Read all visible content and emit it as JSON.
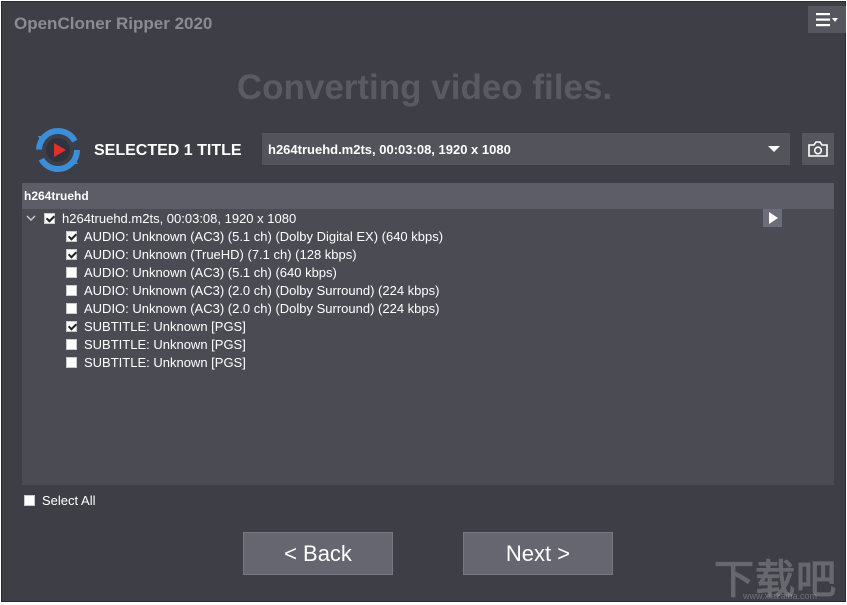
{
  "app": {
    "title": "OpenCloner Ripper 2020",
    "headline": "Converting video files.",
    "menu_icon": "hamburger-menu-icon"
  },
  "selection": {
    "label": "SELECTED 1 TITLE",
    "selected_title": "h264truehd.m2ts, 00:03:08, 1920 x 1080",
    "camera_icon": "camera-icon"
  },
  "panel": {
    "header": "h264truehd",
    "root": {
      "label": "h264truehd.m2ts, 00:03:08, 1920 x 1080",
      "checked": true
    },
    "tracks": [
      {
        "label": "AUDIO: Unknown (AC3) (5.1 ch) (Dolby Digital EX) (640 kbps)",
        "checked": true
      },
      {
        "label": "AUDIO: Unknown (TrueHD) (7.1 ch) (128 kbps)",
        "checked": true
      },
      {
        "label": "AUDIO: Unknown (AC3) (5.1 ch) (640 kbps)",
        "checked": false
      },
      {
        "label": "AUDIO: Unknown (AC3) (2.0 ch) (Dolby Surround) (224 kbps)",
        "checked": false
      },
      {
        "label": "AUDIO: Unknown (AC3) (2.0 ch) (Dolby Surround) (224 kbps)",
        "checked": false
      },
      {
        "label": "SUBTITLE: Unknown [PGS]",
        "checked": true
      },
      {
        "label": "SUBTITLE: Unknown [PGS]",
        "checked": false
      },
      {
        "label": "SUBTITLE: Unknown [PGS]",
        "checked": false
      }
    ]
  },
  "footer": {
    "select_all_label": "Select All",
    "back_label": "<  Back",
    "next_label": "Next  >"
  },
  "watermark": {
    "text": "下载吧",
    "sub": "www.xiazaiba.com"
  },
  "colors": {
    "background": "#3d3e46",
    "panel": "#4a4b53",
    "logo_blue": "#3a8fd8",
    "logo_red": "#e0302a"
  }
}
